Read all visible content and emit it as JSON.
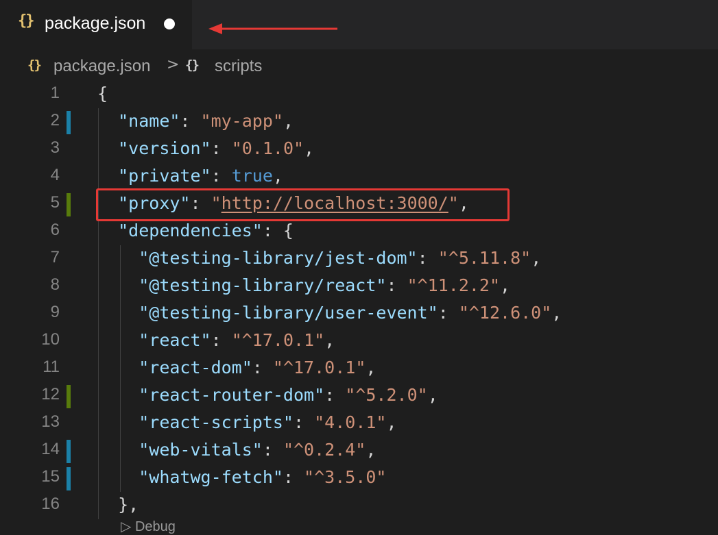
{
  "tab": {
    "icon": "json-braces-icon",
    "icon_glyph": "{}",
    "label": "package.json",
    "dirty": true
  },
  "breadcrumb": {
    "items": [
      {
        "icon": "json-braces-icon",
        "glyph": "{}",
        "label": "package.json"
      },
      {
        "icon": "object-braces-icon",
        "glyph": "{}",
        "label": "scripts"
      }
    ],
    "separator": ">"
  },
  "editor": {
    "lines": [
      {
        "n": "1",
        "marker": ""
      },
      {
        "n": "2",
        "marker": "modified"
      },
      {
        "n": "3",
        "marker": ""
      },
      {
        "n": "4",
        "marker": ""
      },
      {
        "n": "5",
        "marker": "added"
      },
      {
        "n": "6",
        "marker": ""
      },
      {
        "n": "7",
        "marker": ""
      },
      {
        "n": "8",
        "marker": ""
      },
      {
        "n": "9",
        "marker": ""
      },
      {
        "n": "10",
        "marker": ""
      },
      {
        "n": "11",
        "marker": ""
      },
      {
        "n": "12",
        "marker": "added"
      },
      {
        "n": "13",
        "marker": ""
      },
      {
        "n": "14",
        "marker": "modified"
      },
      {
        "n": "15",
        "marker": "modified"
      },
      {
        "n": "16",
        "marker": ""
      }
    ],
    "code": {
      "l1": "{",
      "l2_key": "\"name\"",
      "l2_val": "\"my-app\"",
      "l3_key": "\"version\"",
      "l3_val": "\"0.1.0\"",
      "l4_key": "\"private\"",
      "l4_val": "true",
      "l5_key": "\"proxy\"",
      "l5_val": "http://localhost:3000/",
      "l6_key": "\"dependencies\"",
      "l7_key": "\"@testing-library/jest-dom\"",
      "l7_val": "\"^5.11.8\"",
      "l8_key": "\"@testing-library/react\"",
      "l8_val": "\"^11.2.2\"",
      "l9_key": "\"@testing-library/user-event\"",
      "l9_val": "\"^12.6.0\"",
      "l10_key": "\"react\"",
      "l10_val": "\"^17.0.1\"",
      "l11_key": "\"react-dom\"",
      "l11_val": "\"^17.0.1\"",
      "l12_key": "\"react-router-dom\"",
      "l12_val": "\"^5.2.0\"",
      "l13_key": "\"react-scripts\"",
      "l13_val": "\"4.0.1\"",
      "l14_key": "\"web-vitals\"",
      "l14_val": "\"^0.2.4\"",
      "l15_key": "\"whatwg-fetch\"",
      "l15_val": "\"^3.5.0\"",
      "l16": "},"
    },
    "codelens": "▷ Debug"
  },
  "colors": {
    "modified_marker": "#1b81a8",
    "added_marker": "#587c0c",
    "annotation_red": "#e53935"
  }
}
